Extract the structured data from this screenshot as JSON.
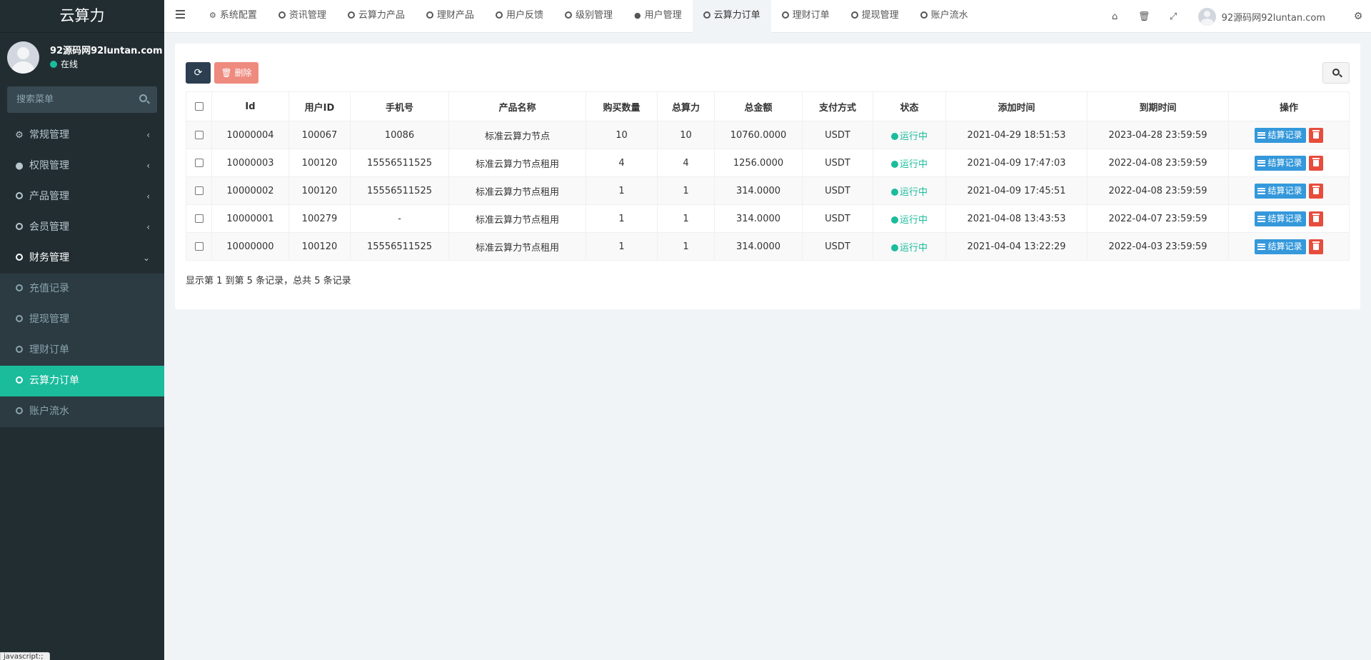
{
  "sidebar": {
    "brand": "云算力",
    "user": {
      "name": "92源码网92luntan.com",
      "status": "在线"
    },
    "search_placeholder": "搜索菜单",
    "menu": [
      {
        "label": "常规管理",
        "icon": "cogs-icon"
      },
      {
        "label": "权限管理",
        "icon": "users-icon"
      },
      {
        "label": "产品管理",
        "icon": "circle-icon"
      },
      {
        "label": "会员管理",
        "icon": "circle-icon"
      },
      {
        "label": "财务管理",
        "icon": "circle-icon"
      }
    ],
    "submenu": [
      {
        "label": "充值记录"
      },
      {
        "label": "提现管理"
      },
      {
        "label": "理财订单"
      },
      {
        "label": "云算力订单"
      },
      {
        "label": "账户流水"
      }
    ],
    "status_tip": "javascript:;"
  },
  "topnav": {
    "tabs": [
      {
        "label": "系统配置"
      },
      {
        "label": "资讯管理"
      },
      {
        "label": "云算力产品"
      },
      {
        "label": "理财产品"
      },
      {
        "label": "用户反馈"
      },
      {
        "label": "级别管理"
      },
      {
        "label": "用户管理"
      },
      {
        "label": "云算力订单"
      },
      {
        "label": "理财订单"
      },
      {
        "label": "提现管理"
      },
      {
        "label": "账户流水"
      }
    ],
    "user": "92源码网92luntan.com"
  },
  "toolbar": {
    "delete_label": "删除"
  },
  "table": {
    "headers": [
      "Id",
      "用户ID",
      "手机号",
      "产品名称",
      "购买数量",
      "总算力",
      "总金额",
      "支付方式",
      "状态",
      "添加时间",
      "到期时间",
      "操作"
    ],
    "rows": [
      {
        "id": "10000004",
        "uid": "100067",
        "phone": "10086",
        "product": "标准云算力节点",
        "qty": "10",
        "power": "10",
        "amount": "10760.0000",
        "pay": "USDT",
        "status": "运行中",
        "added": "2021-04-29 18:51:53",
        "expire": "2023-04-28 23:59:59"
      },
      {
        "id": "10000003",
        "uid": "100120",
        "phone": "15556511525",
        "product": "标准云算力节点租用",
        "qty": "4",
        "power": "4",
        "amount": "1256.0000",
        "pay": "USDT",
        "status": "运行中",
        "added": "2021-04-09 17:47:03",
        "expire": "2022-04-08 23:59:59"
      },
      {
        "id": "10000002",
        "uid": "100120",
        "phone": "15556511525",
        "product": "标准云算力节点租用",
        "qty": "1",
        "power": "1",
        "amount": "314.0000",
        "pay": "USDT",
        "status": "运行中",
        "added": "2021-04-09 17:45:51",
        "expire": "2022-04-08 23:59:59"
      },
      {
        "id": "10000001",
        "uid": "100279",
        "phone": "-",
        "product": "标准云算力节点租用",
        "qty": "1",
        "power": "1",
        "amount": "314.0000",
        "pay": "USDT",
        "status": "运行中",
        "added": "2021-04-08 13:43:53",
        "expire": "2022-04-07 23:59:59"
      },
      {
        "id": "10000000",
        "uid": "100120",
        "phone": "15556511525",
        "product": "标准云算力节点租用",
        "qty": "1",
        "power": "1",
        "amount": "314.0000",
        "pay": "USDT",
        "status": "运行中",
        "added": "2021-04-04 13:22:29",
        "expire": "2022-04-03 23:59:59"
      }
    ],
    "action_label": "结算记录",
    "footer": "显示第 1 到第 5 条记录，总共 5 条记录"
  },
  "colors": {
    "accent": "#1abc9c",
    "sidebar_bg": "#222d32",
    "primary_btn": "#3498db",
    "danger_btn": "#e74c3c"
  }
}
